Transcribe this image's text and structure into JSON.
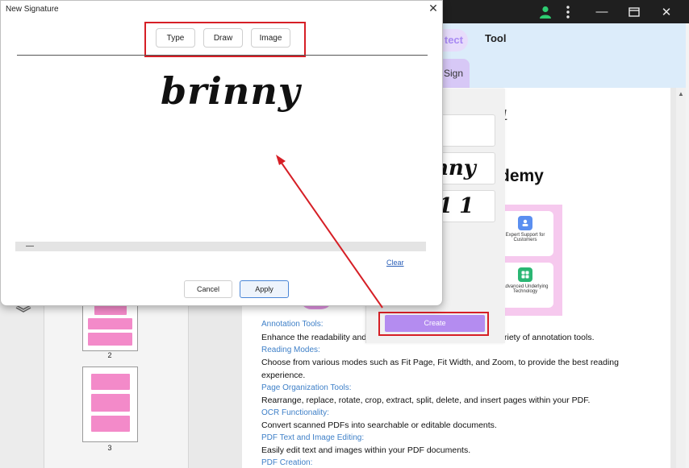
{
  "window": {
    "user_icon": "user-icon",
    "menu_icon": "vertical-dots-icon",
    "minimize_glyph": "—",
    "maximize_glyph": "▭",
    "close_glyph": "✕"
  },
  "ribbon": {
    "tab_protect_partial": "tect",
    "tab_tool": "Tool",
    "sign_button_partial": "e Sign"
  },
  "thumbnails": [
    {
      "number": "2"
    },
    {
      "number": "3"
    }
  ],
  "document": {
    "heading_partial": "demy",
    "number_partial": "1",
    "feature_cards": [
      {
        "label": "Expert Support for Customers",
        "icon": "support-icon",
        "color": "#5b8ff0"
      },
      {
        "label": "Advanced Underlying Technology",
        "icon": "grid-icon",
        "color": "#2bb673"
      }
    ],
    "lines": [
      {
        "kind": "link",
        "text": "Annotation Tools:"
      },
      {
        "kind": "text",
        "text": "Enhance the readability and in",
        "right": "riety of annotation tools."
      },
      {
        "kind": "link",
        "text": "Reading Modes:"
      },
      {
        "kind": "text",
        "text": "Choose from various modes such as Fit Page, Fit Width, and Zoom, to provide the best reading"
      },
      {
        "kind": "text",
        "text": "experience."
      },
      {
        "kind": "link",
        "text": "Page Organization Tools:"
      },
      {
        "kind": "text",
        "text": "Rearrange, replace, rotate, crop, extract, split, delete, and insert pages within your PDF."
      },
      {
        "kind": "link",
        "text": "OCR Functionality:"
      },
      {
        "kind": "text",
        "text": "Convert scanned PDFs into searchable or editable documents."
      },
      {
        "kind": "link",
        "text": "PDF Text and Image Editing:"
      },
      {
        "kind": "text",
        "text": "  Easily edit text and images within your PDF documents."
      },
      {
        "kind": "link",
        "text": "PDF Creation:"
      }
    ]
  },
  "sign_panel": {
    "slots": [
      "i",
      "nny",
      "11"
    ],
    "create_label": "Create"
  },
  "modal": {
    "title": "New Signature",
    "close_glyph": "✕",
    "modes": [
      "Type",
      "Draw",
      "Image"
    ],
    "signature_text": "brinny",
    "clear_label": "Clear",
    "cancel_label": "Cancel",
    "apply_label": "Apply"
  },
  "colors": {
    "highlight_red": "#d61f26",
    "create_purple": "#b48cf0",
    "ribbon_blue": "#dcecfa"
  }
}
